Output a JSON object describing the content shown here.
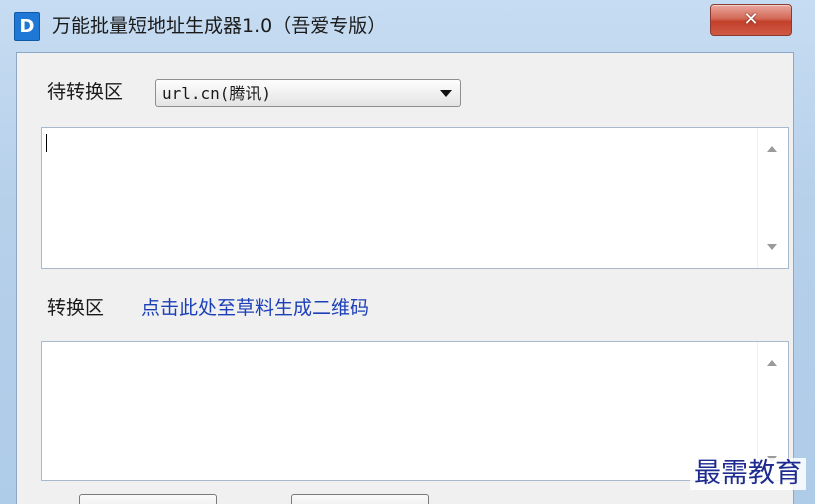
{
  "window": {
    "icon_letter": "D",
    "title": "万能批量短地址生成器1.0（吾爱专版）",
    "close_glyph": "✕"
  },
  "input_section": {
    "label": "待转换区",
    "service_select": {
      "selected": "url.cn(腾讯)"
    },
    "textarea_value": ""
  },
  "output_section": {
    "label": "转换区",
    "qr_link": "点击此处至草料生成二维码",
    "textarea_value": ""
  },
  "watermark": "最需教育",
  "colors": {
    "link": "#1c3fb8",
    "close_button": "#c2402a",
    "title_icon": "#1f78d6",
    "watermark": "#1d2a8f"
  }
}
